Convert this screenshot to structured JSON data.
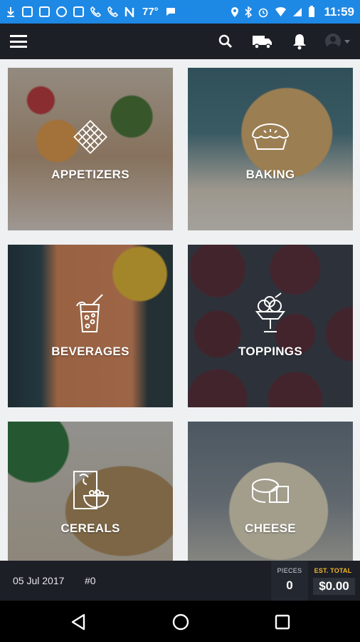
{
  "status_bar": {
    "temperature": "77°",
    "time": "11:59"
  },
  "app_bar": {
    "menu_icon": "hamburger-menu-icon",
    "search_icon": "search-icon",
    "delivery_icon": "truck-icon",
    "notifications_icon": "bell-icon",
    "account_icon": "account-avatar-icon"
  },
  "categories": [
    {
      "label": "APPETIZERS",
      "icon": "appetizer-grid-icon"
    },
    {
      "label": "BAKING",
      "icon": "pie-icon"
    },
    {
      "label": "BEVERAGES",
      "icon": "drink-glass-icon"
    },
    {
      "label": "TOPPINGS",
      "icon": "ice-cream-sundae-icon"
    },
    {
      "label": "CEREALS",
      "icon": "cereal-box-bowl-icon"
    },
    {
      "label": "CHEESE",
      "icon": "cheese-icon"
    }
  ],
  "order_summary": {
    "date": "05 Jul 2017",
    "order_number": "#0",
    "pieces_label": "PIECES",
    "pieces_value": "0",
    "total_label": "EST. TOTAL",
    "total_value": "$0.00"
  },
  "colors": {
    "status_bar": "#1e88e5",
    "app_bar": "#1c1f26",
    "accent": "#f2b52a"
  }
}
